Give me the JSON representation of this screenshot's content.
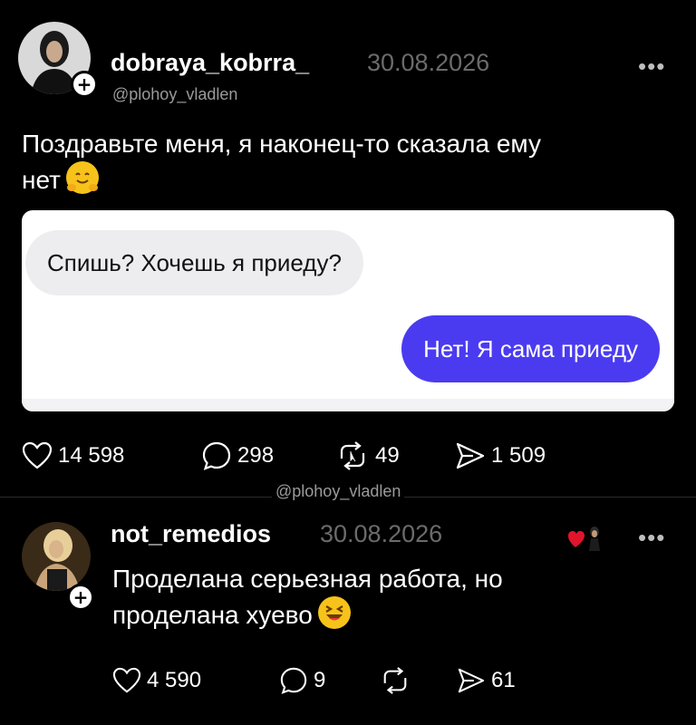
{
  "post1": {
    "username": "dobraya_kobrra_",
    "date": "30.08.2026",
    "handle": "@plohoy_vladlen",
    "more": "•••",
    "text_line1": "Поздравьте меня, я наконец-то сказала ему",
    "text_line2": "нет",
    "chat": {
      "incoming": "Спишь? Хочешь я приеду?",
      "outgoing": "Нет! Я сама приеду"
    },
    "likes": "14 598",
    "comments": "298",
    "reposts": "49",
    "shares": "1 509"
  },
  "watermark": "@plohoy_vladlen",
  "post2": {
    "username": "not_remedios",
    "date": "30.08.2026",
    "more": "•••",
    "text_line1": "Проделана серьезная работа, но",
    "text_line2": "проделана хуево",
    "likes": "4 590",
    "comments": "9",
    "shares": "61"
  },
  "colors": {
    "background": "#000000",
    "outgoing_bubble": "#4b3bf0",
    "incoming_bubble": "#ededf0",
    "date_gray": "#6b6b6b"
  }
}
